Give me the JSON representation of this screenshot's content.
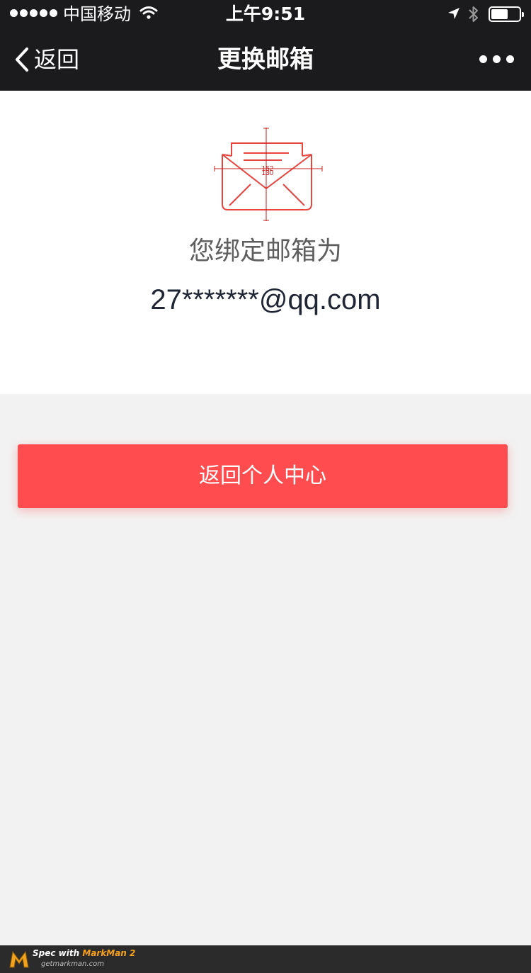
{
  "status_bar": {
    "carrier": "中国移动",
    "time": "上午9:51",
    "battery_level": 0.6
  },
  "nav": {
    "back_label": "返回",
    "title": "更换邮箱"
  },
  "main": {
    "envelope_measure_top": "152",
    "envelope_measure_bottom": "130",
    "label": "您绑定邮箱为",
    "email": "27*******@qq.com"
  },
  "actions": {
    "return_label": "返回个人中心"
  },
  "footer": {
    "brand_prefix": "Spec with ",
    "brand_name": "MarkMan 2",
    "site": "getmarkman.com"
  },
  "colors": {
    "topbar": "#1b1b1e",
    "accent": "#ff4c4f",
    "icon": "#e64540",
    "background": "#f2f2f2"
  }
}
